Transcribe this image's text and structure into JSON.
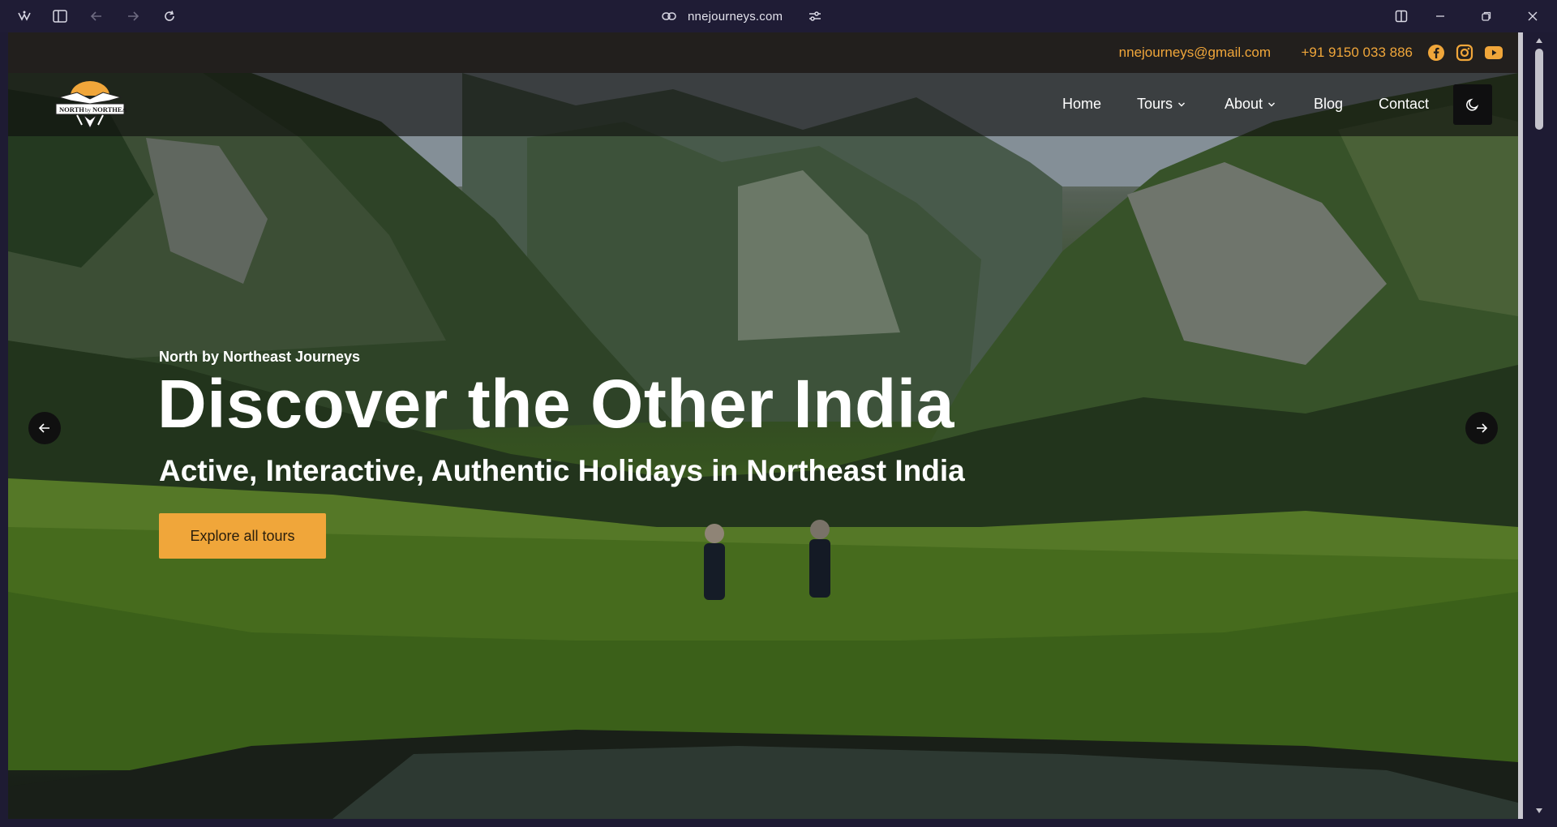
{
  "browser": {
    "url": "nnejourneys.com",
    "icons": [
      "app-logo-icon",
      "sidebar-toggle-icon",
      "back-icon",
      "forward-icon",
      "reload-icon",
      "link-icon",
      "site-settings-icon",
      "split-view-icon",
      "minimize-icon",
      "restore-icon",
      "close-icon"
    ]
  },
  "topbar": {
    "email": "nnejourneys@gmail.com",
    "phone": "+91 9150 033 886",
    "social": [
      "facebook-icon",
      "instagram-icon",
      "youtube-icon"
    ],
    "accent_color": "#f0a63a"
  },
  "logo": {
    "text_top": "NORTH",
    "text_mid": "by",
    "text_right": "NORTHEAST"
  },
  "nav": {
    "items": [
      {
        "label": "Home",
        "has_dropdown": false
      },
      {
        "label": "Tours",
        "has_dropdown": true
      },
      {
        "label": "About",
        "has_dropdown": true
      },
      {
        "label": "Blog",
        "has_dropdown": false
      },
      {
        "label": "Contact",
        "has_dropdown": false
      }
    ],
    "theme_toggle_icon": "moon-icon"
  },
  "hero": {
    "eyebrow": "North by Northeast Journeys",
    "headline": "Discover the Other India",
    "subheadline": "Active, Interactive, Authentic Holidays in Northeast India",
    "cta_label": "Explore all tours",
    "prev_icon": "arrow-left-icon",
    "next_icon": "arrow-right-icon"
  }
}
